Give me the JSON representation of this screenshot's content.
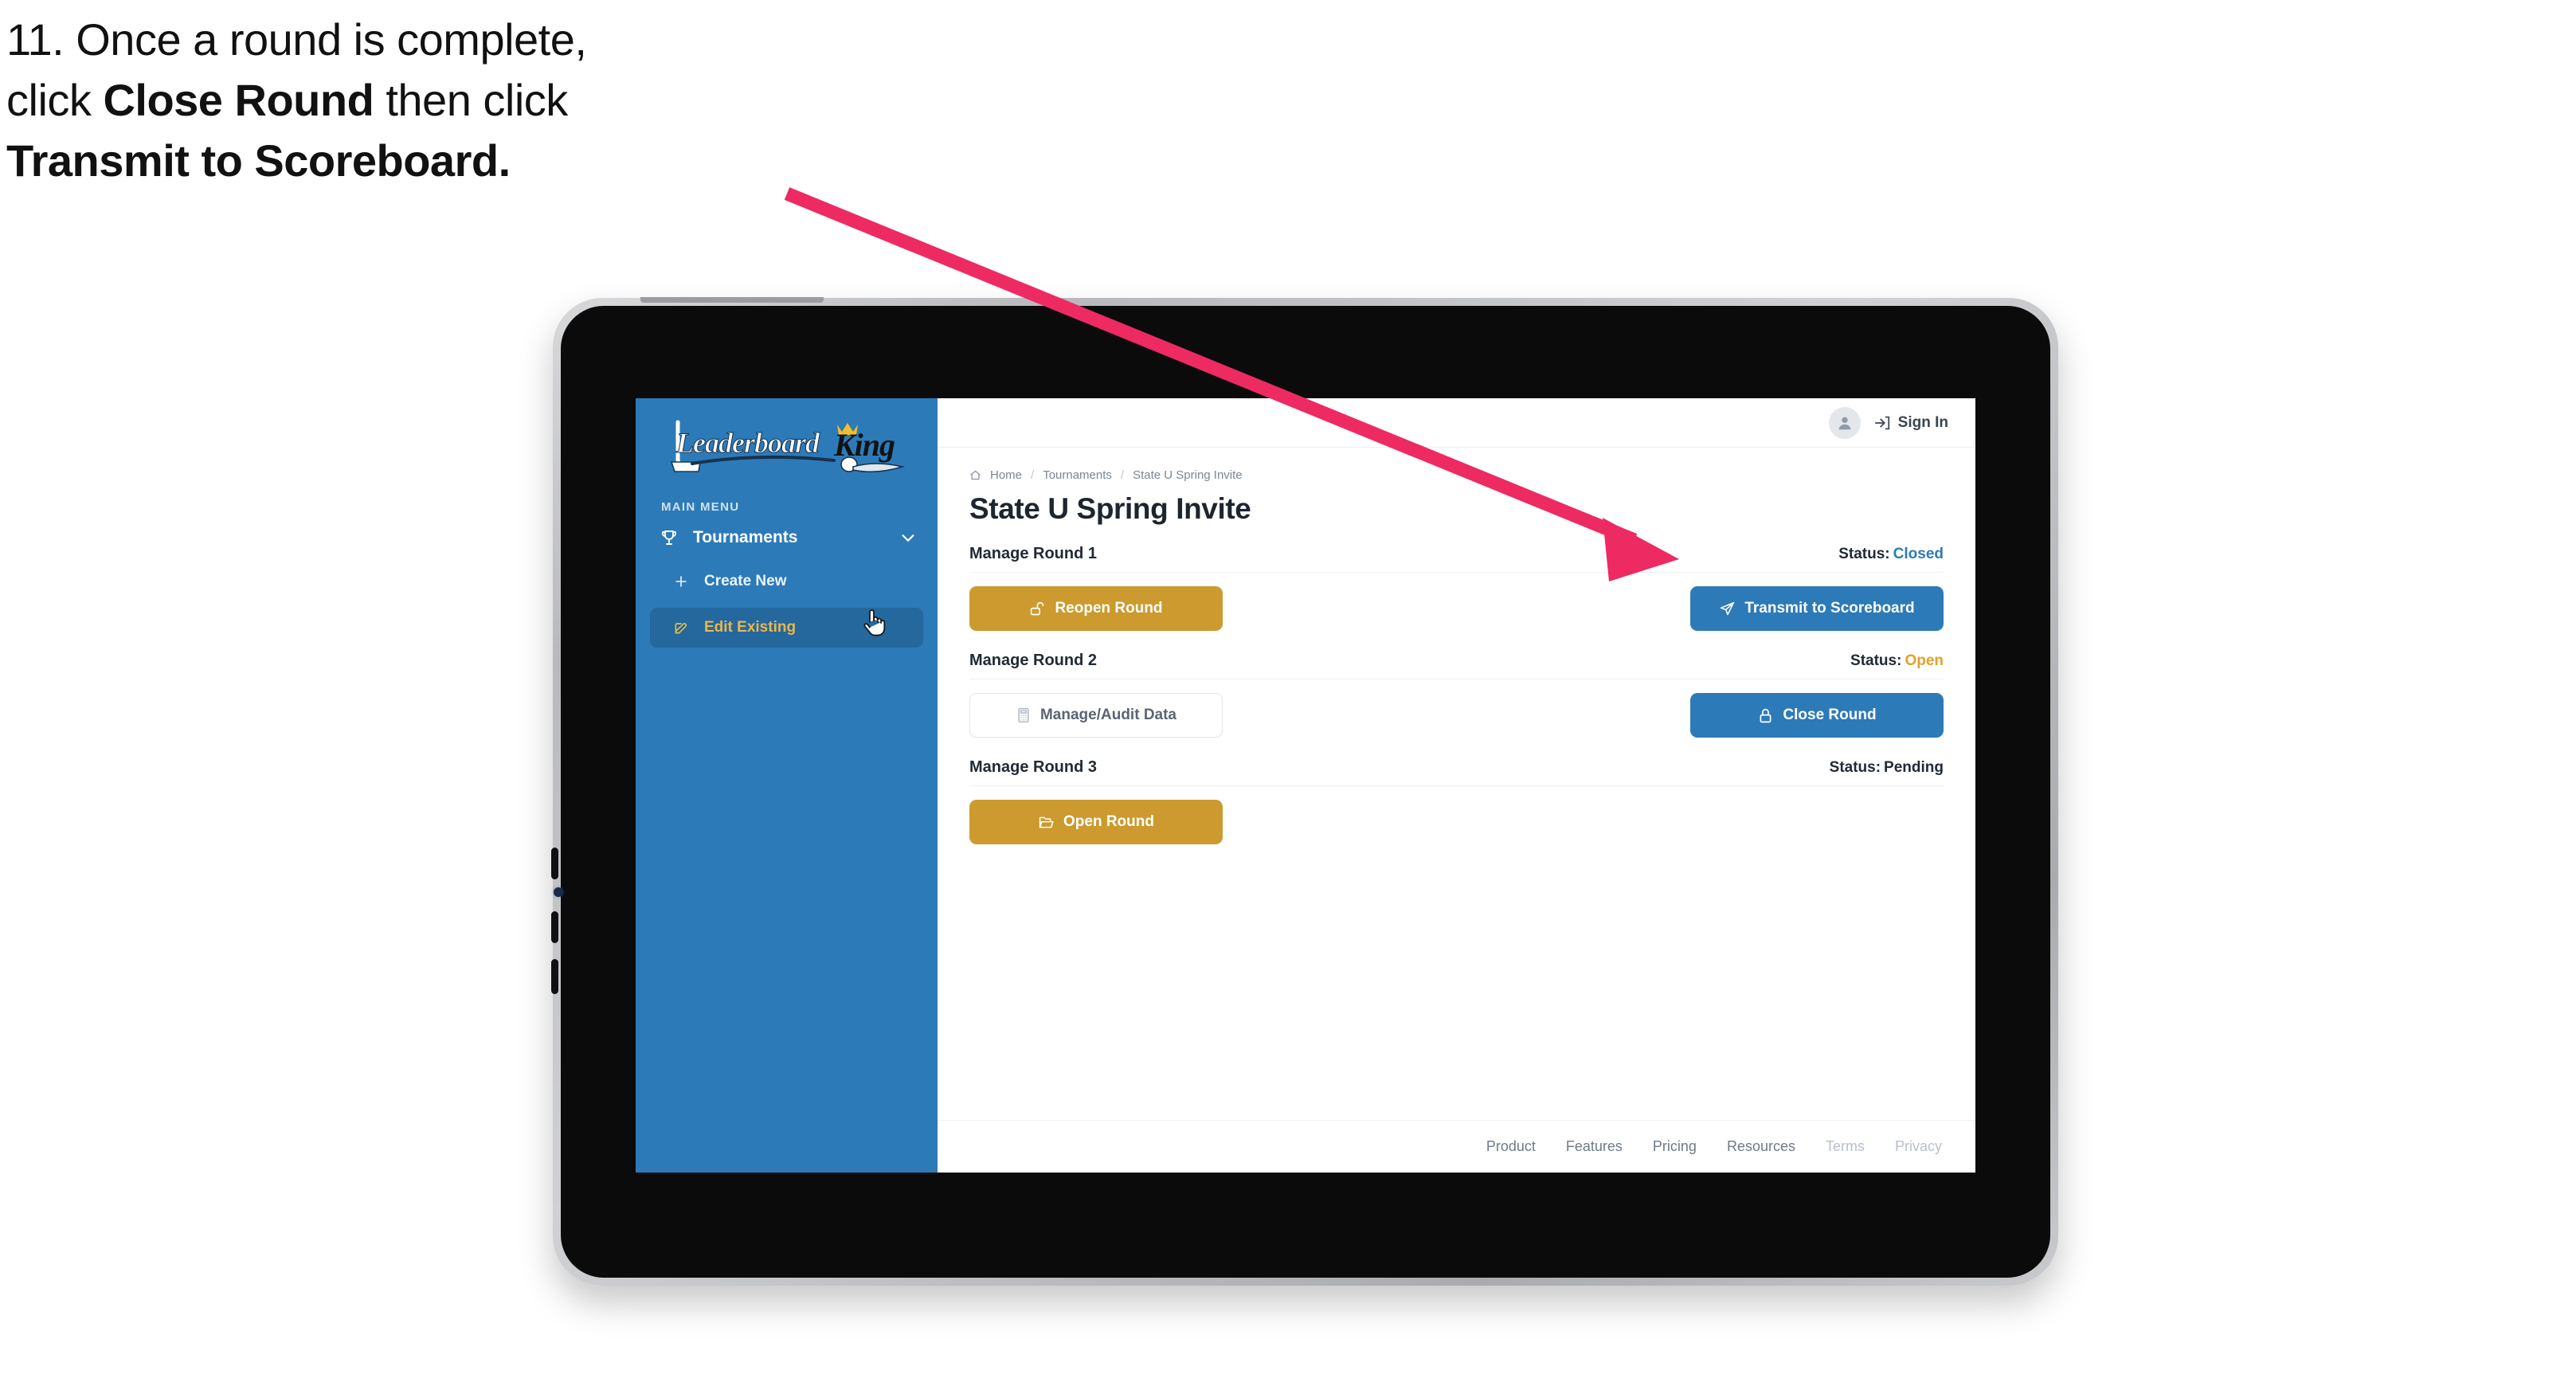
{
  "instruction": {
    "line1": "11. Once a round is complete,",
    "line2_pre": "click ",
    "line2_bold": "Close Round",
    "line2_post": " then click",
    "line3_bold": "Transmit to Scoreboard."
  },
  "annotation": {
    "arrow_color": "#ee2a63",
    "arrow_from": "(990, 245)",
    "arrow_to": "(2105, 700)"
  },
  "sidebar": {
    "logo": {
      "word1": "Leaderboard",
      "word2": "King"
    },
    "menu_label": "MAIN MENU",
    "parent": {
      "label": "Tournaments",
      "icon": "trophy-icon",
      "chevron": "chevron-down-icon"
    },
    "items": [
      {
        "label": "Create New",
        "icon": "plus-icon",
        "active": false
      },
      {
        "label": "Edit Existing",
        "icon": "edit-square-icon",
        "active": true
      }
    ],
    "bg_color": "#2d7ab8",
    "active_bg": "#24689e",
    "active_text": "#e8b84b"
  },
  "topbar": {
    "avatar_icon": "user-avatar-icon",
    "signin_icon": "login-arrow-icon",
    "signin_label": "Sign In"
  },
  "breadcrumb": {
    "home_icon": "home-icon",
    "items": [
      "Home",
      "Tournaments",
      "State U Spring Invite"
    ],
    "separator": "/"
  },
  "page": {
    "title": "State U Spring Invite"
  },
  "rounds": [
    {
      "title": "Manage Round 1",
      "status_label": "Status:",
      "status_value": "Closed",
      "status_color": "#2d7ab8",
      "left_button": {
        "label": "Reopen Round",
        "icon": "unlock-icon",
        "style": "gold"
      },
      "right_button": {
        "label": "Transmit to Scoreboard",
        "icon": "paper-plane-icon",
        "style": "blue"
      }
    },
    {
      "title": "Manage Round 2",
      "status_label": "Status:",
      "status_value": "Open",
      "status_color": "#e0a12c",
      "left_button": {
        "label": "Manage/Audit Data",
        "icon": "calculator-icon",
        "style": "ghost"
      },
      "right_button": {
        "label": "Close Round",
        "icon": "lock-icon",
        "style": "blue"
      }
    },
    {
      "title": "Manage Round 3",
      "status_label": "Status:",
      "status_value": "Pending",
      "status_color": "#222a35",
      "left_button": {
        "label": "Open Round",
        "icon": "open-folder-icon",
        "style": "gold"
      },
      "right_button": null
    }
  ],
  "footer": {
    "links": [
      {
        "label": "Product",
        "dim": false
      },
      {
        "label": "Features",
        "dim": false
      },
      {
        "label": "Pricing",
        "dim": false
      },
      {
        "label": "Resources",
        "dim": false
      },
      {
        "label": "Terms",
        "dim": true
      },
      {
        "label": "Privacy",
        "dim": true
      }
    ]
  }
}
